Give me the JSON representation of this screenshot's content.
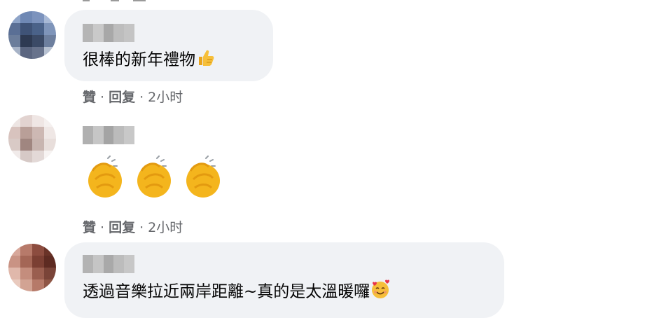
{
  "comments": [
    {
      "text": "很棒的新年禮物",
      "emoji": "thumbs-up",
      "actions": {
        "like": "贊",
        "reply": "回复",
        "time": "2小时"
      }
    },
    {
      "text": "",
      "emoji": "clapping-hands x3",
      "actions": {
        "like": "贊",
        "reply": "回复",
        "time": "2小时"
      }
    },
    {
      "text": "透過音樂拉近兩岸距離~真的是太溫暖囉",
      "emoji": "smiling-face-with-hearts"
    }
  ],
  "colors": {
    "bubble": "#f0f2f5",
    "text": "#050505",
    "meta": "#65676b"
  }
}
